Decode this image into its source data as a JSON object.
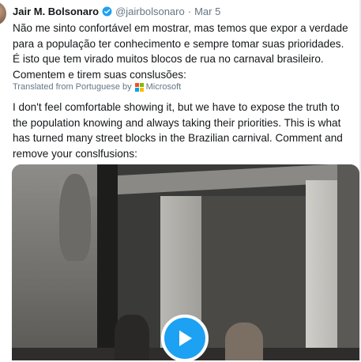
{
  "tweet": {
    "author_name": "Jair M. Bolsonaro",
    "handle": "@jairbolsonaro",
    "separator": "·",
    "date": "Mar 5",
    "text": "Não me sinto confortável em mostrar, mas temos que expor a verdade para a população ter conhecimento e sempre tomar suas prioridades. É isto que tem virado muitos blocos de rua no carnaval brasileiro. Comentem e tirem suas conslusões:",
    "translated_label": "Translated from Portuguese by",
    "translator_name": "Microsoft",
    "translated_text": "I don't feel comfortable showing it, but we have to expose the truth to the population knowing and always taking their priorities. This is what has turned many street blocks in the Brazilian carnival. Comment and remove your conslfusions:"
  },
  "colors": {
    "verified": "#1da1f2",
    "play_button": "#1da1f2",
    "secondary_text": "#657786",
    "ms_red": "#f25022",
    "ms_green": "#7fba00",
    "ms_blue": "#00a4ef",
    "ms_yellow": "#ffb900"
  },
  "icons": {
    "verified": "verified-badge-icon",
    "play": "play-icon",
    "translator": "microsoft-logo-icon"
  }
}
